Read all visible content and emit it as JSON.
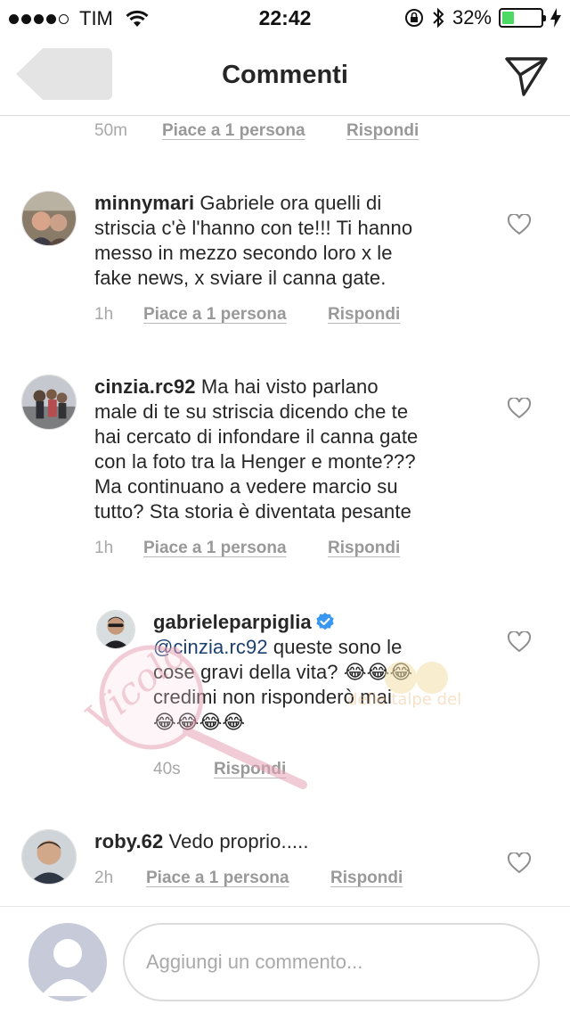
{
  "status_bar": {
    "carrier": "TIM",
    "time": "22:42",
    "battery": "32%",
    "battery_level": 0.32
  },
  "nav": {
    "title": "Commenti",
    "back_icon": "back-arrow-icon",
    "send_icon": "paper-plane-icon"
  },
  "top_meta": {
    "time": "50m",
    "likes": "Piace a 1 persona",
    "reply": "Rispondi"
  },
  "comments": [
    {
      "username": "minnymari",
      "text_lines": [
        "Gabriele ora quelli di",
        "striscia c'è l'hanno con te!!! Ti hanno",
        "messo in mezzo secondo loro x le",
        "fake news, x sviare il canna gate."
      ],
      "time": "1h",
      "likes": "Piace a 1 persona",
      "reply": "Rispondi"
    },
    {
      "username": "cinzia.rc92",
      "text_lines": [
        "Ma hai visto parlano",
        "male di te su striscia dicendo che te",
        "hai cercato di infondare il canna gate",
        "con la foto tra la Henger e monte???",
        "Ma continuano a vedere marcio su",
        "tutto? Sta storia è diventata pesante"
      ],
      "time": "1h",
      "likes": "Piace a 1 persona",
      "reply": "Rispondi"
    },
    {
      "username": "gabrieleparpiglia",
      "mention": "@cinzia.rc92",
      "text_lines": [
        "queste sono le",
        "cose gravi della vita? 😂😂😂",
        "credimi non risponderò mai",
        "😂😂😂😂"
      ],
      "time": "40s",
      "reply": "Rispondi"
    },
    {
      "username": "roby.62",
      "text_lines": [
        "Vedo proprio....."
      ],
      "time": "2h",
      "likes": "Piace a 1 persona",
      "reply": "Rispondi"
    }
  ],
  "input": {
    "placeholder": "Aggiungi un commento..."
  },
  "colors": {
    "text": "#262626",
    "meta": "#999999",
    "mention": "#1b3f6e",
    "verified": "#3897f0",
    "battery": "#4cd964"
  }
}
